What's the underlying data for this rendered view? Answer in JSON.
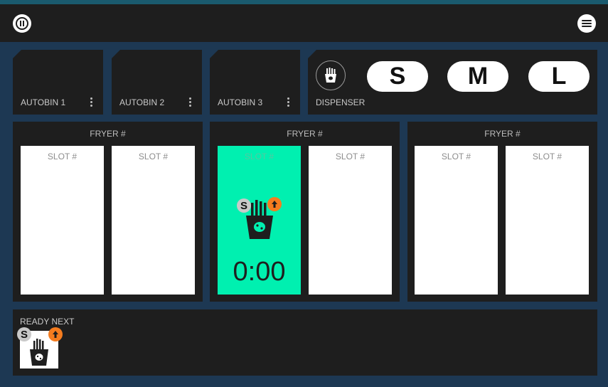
{
  "topbar": {
    "pause_icon": "pause-icon",
    "menu_icon": "hamburger-menu-icon"
  },
  "autobins": [
    {
      "label": "AUTOBIN 1"
    },
    {
      "label": "AUTOBIN 2"
    },
    {
      "label": "AUTOBIN 3"
    }
  ],
  "dispenser": {
    "label": "DISPENSER",
    "icon": "fries-icon",
    "sizes": [
      "S",
      "M",
      "L"
    ]
  },
  "fryers": [
    {
      "title": "FRYER #",
      "slots": [
        {
          "label": "SLOT #"
        },
        {
          "label": "SLOT #"
        }
      ]
    },
    {
      "title": "FRYER #",
      "slots": [
        {
          "label": "SLOT #",
          "active": true,
          "size_badge": "S",
          "timer": "0:00"
        },
        {
          "label": "SLOT #"
        }
      ]
    },
    {
      "title": "FRYER #",
      "slots": [
        {
          "label": "SLOT #"
        },
        {
          "label": "SLOT #"
        }
      ]
    }
  ],
  "ready_next": {
    "label": "READY NEXT",
    "size_badge": "S"
  },
  "colors": {
    "active_slot": "#00f0b0",
    "badge_orange": "#f57c1f",
    "panel": "#1e1e1e",
    "background": "#1d3853"
  }
}
